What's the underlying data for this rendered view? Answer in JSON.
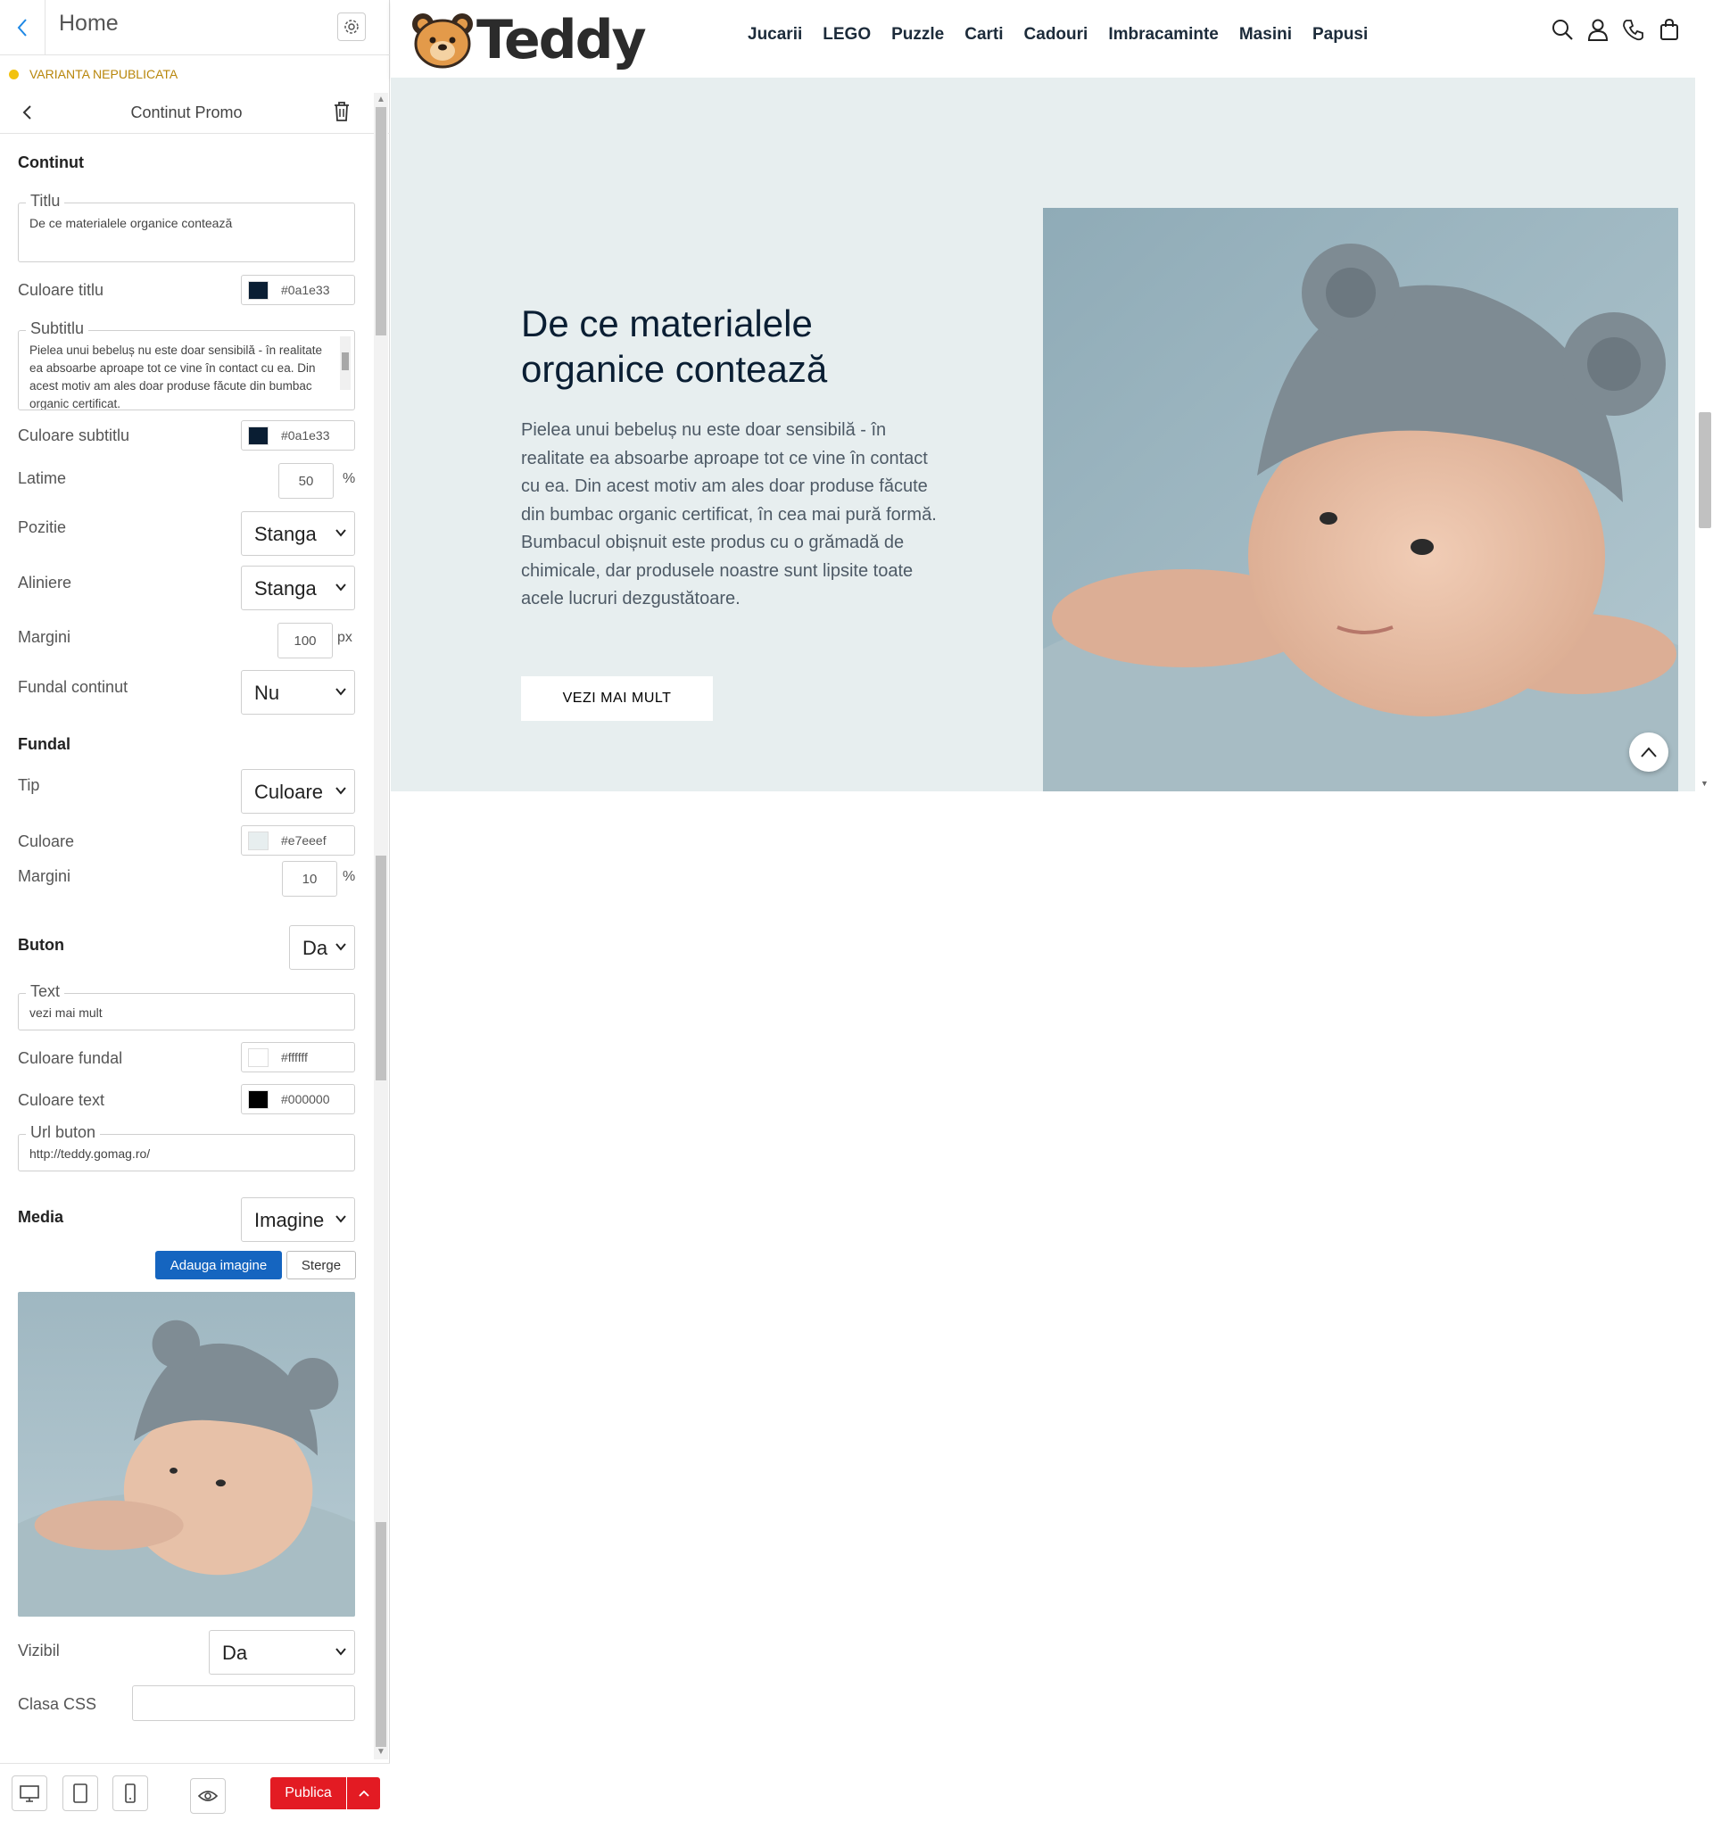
{
  "editor": {
    "title": "Home",
    "status": "VARIANTA NEPUBLICATA",
    "section_title": "Continut Promo",
    "continut": {
      "heading": "Continut",
      "titlu_label": "Titlu",
      "titlu_value": "De ce materialele organice contează",
      "culoare_titlu_label": "Culoare titlu",
      "culoare_titlu_value": "#0a1e33",
      "subtitlu_label": "Subtitlu",
      "subtitlu_value": "Pielea unui bebeluș nu este doar sensibilă - în realitate ea absoarbe aproape tot ce vine în contact cu ea. Din acest motiv am ales doar produse făcute din bumbac organic certificat.",
      "culoare_subtitlu_label": "Culoare subtitlu",
      "culoare_subtitlu_value": "#0a1e33",
      "latime_label": "Latime",
      "latime_value": "50",
      "latime_unit": "%",
      "pozitie_label": "Pozitie",
      "pozitie_value": "Stanga",
      "aliniere_label": "Aliniere",
      "aliniere_value": "Stanga",
      "margini_label": "Margini",
      "margini_value": "100",
      "margini_unit": "px",
      "fundal_continut_label": "Fundal continut",
      "fundal_continut_value": "Nu"
    },
    "fundal": {
      "heading": "Fundal",
      "tip_label": "Tip",
      "tip_value": "Culoare",
      "culoare_label": "Culoare",
      "culoare_value": "#e7eeef",
      "margini_label": "Margini",
      "margini_value": "10",
      "margini_unit": "%"
    },
    "buton": {
      "heading": "Buton",
      "enabled_value": "Da",
      "text_label": "Text",
      "text_value": "vezi mai mult",
      "culoare_fundal_label": "Culoare fundal",
      "culoare_fundal_value": "#ffffff",
      "culoare_text_label": "Culoare text",
      "culoare_text_value": "#000000",
      "url_label": "Url buton",
      "url_value": "http://teddy.gomag.ro/"
    },
    "media": {
      "heading": "Media",
      "type_value": "Imagine",
      "add_label": "Adauga imagine",
      "delete_label": "Sterge"
    },
    "vizibil_label": "Vizibil",
    "vizibil_value": "Da",
    "clasa_css_label": "Clasa CSS",
    "clasa_css_value": "",
    "publish_label": "Publica"
  },
  "site": {
    "logo_text": "Teddy",
    "nav": [
      "Jucarii",
      "LEGO",
      "Puzzle",
      "Carti",
      "Cadouri",
      "Imbracaminte",
      "Masini",
      "Papusi"
    ],
    "header_icons": [
      "search-icon",
      "user-icon",
      "phone-icon",
      "cart-icon"
    ],
    "promo": {
      "title": "De ce materialele organice contează",
      "subtitle": "Pielea unui bebeluș nu este doar sensibilă - în realitate ea absoarbe aproape tot ce vine în contact cu ea. Din acest motiv am ales doar produse făcute din bumbac organic certificat, în cea mai pură formă. Bumbacul obișnuit este produs cu o grămadă de chimicale, dar produsele noastre sunt lipsite toate acele lucruri dezgustătoare.",
      "button": "VEZI MAI MULT",
      "bg_color": "#e7eeef",
      "title_color": "#0a1e33"
    }
  }
}
